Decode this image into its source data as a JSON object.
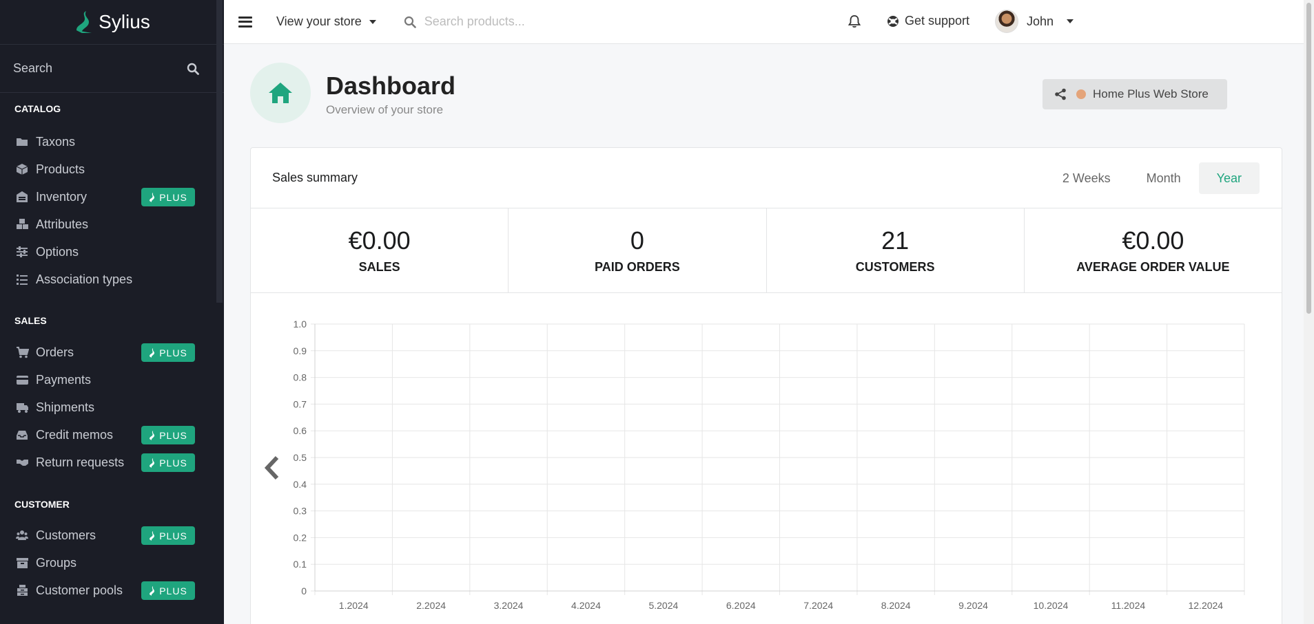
{
  "brand": {
    "name": "Sylius"
  },
  "sidebar": {
    "search_label": "Search",
    "sections": [
      {
        "title": "CATALOG",
        "items": [
          {
            "label": "Taxons",
            "icon": "folder-icon",
            "plus": false
          },
          {
            "label": "Products",
            "icon": "cube-icon",
            "plus": false
          },
          {
            "label": "Inventory",
            "icon": "warehouse-icon",
            "plus": true
          },
          {
            "label": "Attributes",
            "icon": "cubes-icon",
            "plus": false
          },
          {
            "label": "Options",
            "icon": "sliders-icon",
            "plus": false
          },
          {
            "label": "Association types",
            "icon": "tasks-icon",
            "plus": false
          }
        ]
      },
      {
        "title": "SALES",
        "items": [
          {
            "label": "Orders",
            "icon": "cart-icon",
            "plus": true
          },
          {
            "label": "Payments",
            "icon": "credit-card-icon",
            "plus": false
          },
          {
            "label": "Shipments",
            "icon": "truck-icon",
            "plus": false
          },
          {
            "label": "Credit memos",
            "icon": "inbox-icon",
            "plus": true
          },
          {
            "label": "Return requests",
            "icon": "handshake-icon",
            "plus": true
          }
        ]
      },
      {
        "title": "CUSTOMER",
        "items": [
          {
            "label": "Customers",
            "icon": "users-icon",
            "plus": true
          },
          {
            "label": "Groups",
            "icon": "archive-icon",
            "plus": false
          },
          {
            "label": "Customer pools",
            "icon": "archive-stack-icon",
            "plus": true
          }
        ]
      }
    ],
    "plus_label": "PLUS"
  },
  "topbar": {
    "view_store": "View your store",
    "search_placeholder": "Search products...",
    "support": "Get support",
    "user": "John"
  },
  "header": {
    "title": "Dashboard",
    "subtitle": "Overview of your store",
    "channel": "Home Plus Web Store"
  },
  "summary": {
    "title": "Sales summary",
    "periods": [
      "2 Weeks",
      "Month",
      "Year"
    ],
    "active_period": "Year",
    "stats": [
      {
        "value": "€0.00",
        "label": "SALES"
      },
      {
        "value": "0",
        "label": "PAID ORDERS"
      },
      {
        "value": "21",
        "label": "CUSTOMERS"
      },
      {
        "value": "€0.00",
        "label": "AVERAGE ORDER VALUE"
      }
    ]
  },
  "colors": {
    "accent": "#1fa57e",
    "sidebar_bg": "#1b1d26",
    "channel_dot": "#e4a47a"
  },
  "chart_data": {
    "type": "line",
    "categories": [
      "1.2024",
      "2.2024",
      "3.2024",
      "4.2024",
      "5.2024",
      "6.2024",
      "7.2024",
      "8.2024",
      "9.2024",
      "10.2024",
      "11.2024",
      "12.2024"
    ],
    "series": [],
    "y_ticks": [
      "0",
      "0.1",
      "0.2",
      "0.3",
      "0.4",
      "0.5",
      "0.6",
      "0.7",
      "0.8",
      "0.9",
      "1.0"
    ],
    "ylim": [
      0,
      1
    ],
    "grid": true,
    "title": "",
    "xlabel": "",
    "ylabel": ""
  }
}
